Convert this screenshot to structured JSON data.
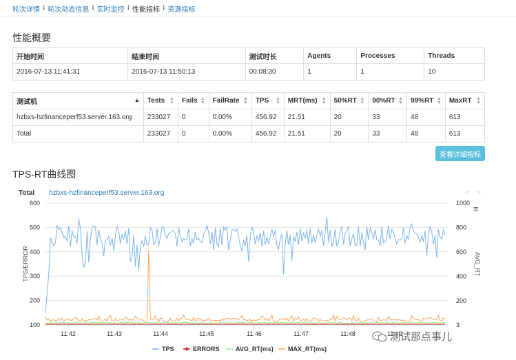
{
  "nav": [
    {
      "label": "轮次详情",
      "current": false
    },
    {
      "label": "轮次动态信息",
      "current": false
    },
    {
      "label": "实时监控",
      "current": false
    },
    {
      "label": "性能指标",
      "current": true
    },
    {
      "label": "资源指标",
      "current": false
    }
  ],
  "overview": {
    "title": "性能概要",
    "headers": [
      "开始时间",
      "结束时间",
      "测试时长",
      "Agents",
      "Processes",
      "Threads"
    ],
    "row": [
      "2016-07-13 11:41:31",
      "2016-07-13 11:50:13",
      "00:08:30",
      "1",
      "1",
      "10"
    ]
  },
  "stats": {
    "headers": [
      "测试机",
      "Tests",
      "Fails",
      "FailRate",
      "TPS",
      "MRT(ms)",
      "50%RT",
      "90%RT",
      "99%RT",
      "MaxRT"
    ],
    "rows": [
      [
        "hzbxs-hzfinanceperf53.server.163.org",
        "233027",
        "0",
        "0.00%",
        "456.92",
        "21.51",
        "20",
        "33",
        "48",
        "613"
      ],
      [
        "Total",
        "233027",
        "0",
        "0.00%",
        "456.92",
        "21.51",
        "20",
        "33",
        "48",
        "613"
      ]
    ]
  },
  "detail_button": "查看详细指标",
  "chart_section_title": "TPS-RT曲线图",
  "chart_tabs": [
    "Total",
    "hzbxs-hzfinanceperf53.server.163.org"
  ],
  "pager": [
    "<",
    ">"
  ],
  "menu_icon": "≡",
  "watermark": "测试那点事儿",
  "colors": {
    "tps": "#7cb5ec",
    "errors": "#d9251d",
    "avg": "#90ed7d",
    "max": "#f7a35c",
    "link": "#2a7ab5",
    "button": "#5bc0de"
  },
  "chart_data": {
    "type": "line",
    "x": [
      "11:42",
      "11:43",
      "11:44",
      "11:45",
      "11:46",
      "11:47",
      "11:48",
      "11:49"
    ],
    "ylabel": "TPS/ERROR",
    "y2label": "AVG_RT",
    "yticks": [
      "600",
      "500",
      "400",
      "300",
      "200",
      "100"
    ],
    "y2ticks": [
      "1000",
      "800",
      "600",
      "400",
      "200",
      "3"
    ],
    "ylim": [
      100,
      600
    ],
    "y2lim": [
      3,
      1000
    ],
    "legend": [
      "TPS",
      "ERRORS",
      "AVG_RT(ms)",
      "MAX_RT(ms)"
    ],
    "legend_position": "bottom",
    "series": [
      {
        "name": "TPS",
        "approx_range": [
          350,
          560
        ],
        "typical": 470
      },
      {
        "name": "ERRORS",
        "value": 0
      },
      {
        "name": "AVG_RT(ms)",
        "typical": 20
      },
      {
        "name": "MAX_RT(ms)",
        "typical": 40,
        "spike_at": "11:43.8",
        "spike_value": 613
      }
    ]
  }
}
